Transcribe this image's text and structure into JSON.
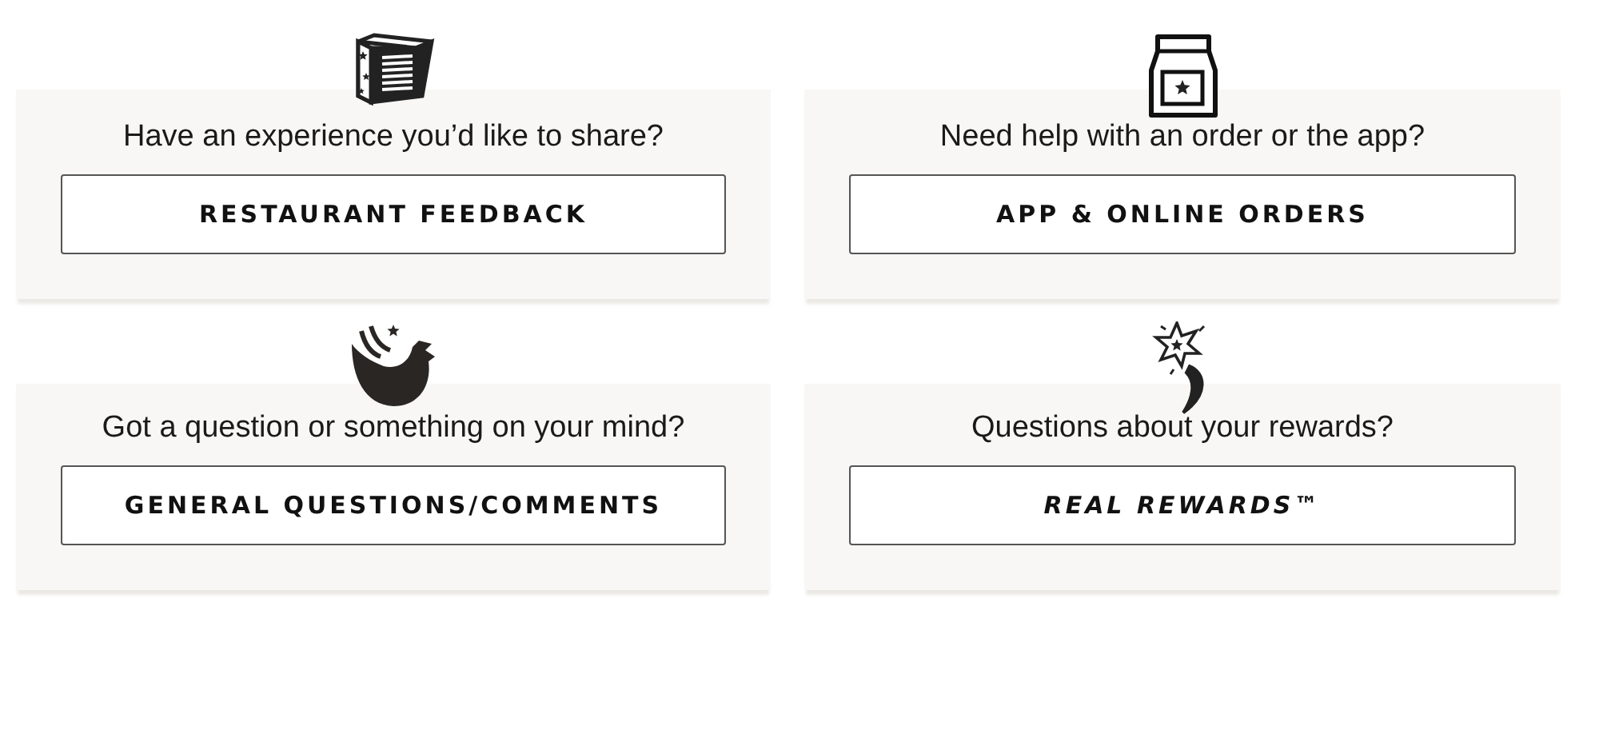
{
  "cards": [
    {
      "question": "Have an experience you’d like to share?",
      "button": {
        "label": "RESTAURANT FEEDBACK",
        "italic": false
      }
    },
    {
      "question": "Need help with an order or the app?",
      "button": {
        "label": "APP & ONLINE ORDERS",
        "italic": false
      }
    },
    {
      "question": "Got a question or something on your mind?",
      "button": {
        "label": "GENERAL QUESTIONS/COMMENTS",
        "italic": false
      }
    },
    {
      "question": "Questions about your rewards?",
      "button": {
        "label": "REAL REWARDS™",
        "italic": true
      }
    }
  ]
}
